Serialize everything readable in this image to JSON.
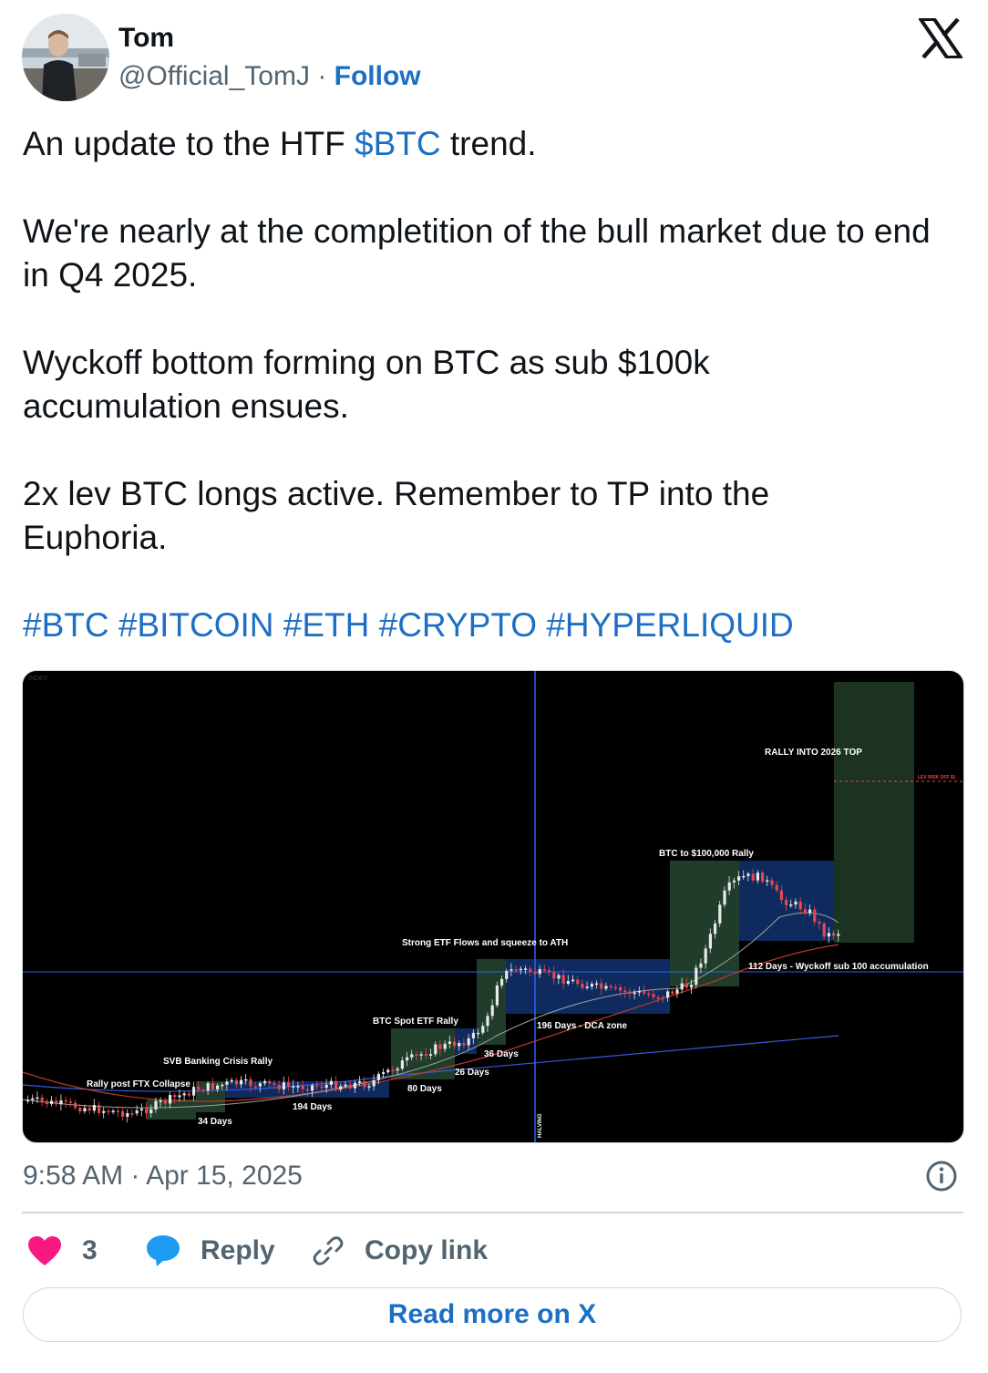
{
  "author": {
    "name": "Tom",
    "handle": "@Official_TomJ",
    "separator": "·",
    "follow_label": "Follow",
    "avatar_icon": "profile-photo"
  },
  "platform": {
    "logo_icon": "x-logo"
  },
  "tweet": {
    "lines": {
      "l1_before": "An update to the HTF ",
      "l1_cashtag": "$BTC",
      "l1_after": " trend.",
      "p2": "We're nearly at the completition of the bull market due to end in Q4 2025.",
      "p3": "Wyckoff bottom forming on BTC as sub $100k accumulation ensues.",
      "p4": "2x lev BTC longs active. Remember to TP into the Euphoria.",
      "hashtags": "#BTC #BITCOIN #ETH #CRYPTO #HYPERLIQUID"
    },
    "link_color": "#1d6fc4"
  },
  "chart_image": {
    "annotations": {
      "rally_top": "RALLY INTO 2026 TOP",
      "lev_risk": "LEV RISK OFF $1",
      "btc_100k": "BTC to $100,000 Rally",
      "etf_flows": "Strong ETF Flows and squeeze to ATH",
      "wyckoff": "112 Days - Wyckoff sub 100 accumulation",
      "spot_etf": "BTC Spot ETF Rally",
      "dca": "196 Days - DCA zone",
      "svb": "SVB Banking Crisis Rally",
      "d36": "36 Days",
      "d26": "26 Days",
      "ftx": "Rally post FTX Collapse",
      "d80": "80 Days",
      "d194": "194 Days",
      "d34": "34 Days",
      "halving": "HALVING",
      "watermark": "INDEX"
    },
    "colors": {
      "up": "#e8e8e8",
      "down": "#e5484d",
      "zone_green": "#1f3d2a",
      "zone_blue": "#0f2a5e",
      "crosshair": "#2962ff"
    }
  },
  "meta": {
    "timestamp": "9:58 AM · Apr 15, 2025",
    "info_icon": "info-icon"
  },
  "actions": {
    "like_count": "3",
    "like_icon": "heart-icon",
    "reply_label": "Reply",
    "reply_icon": "speech-bubble-icon",
    "copy_label": "Copy link",
    "copy_icon": "link-icon",
    "read_more_label": "Read more on X"
  }
}
